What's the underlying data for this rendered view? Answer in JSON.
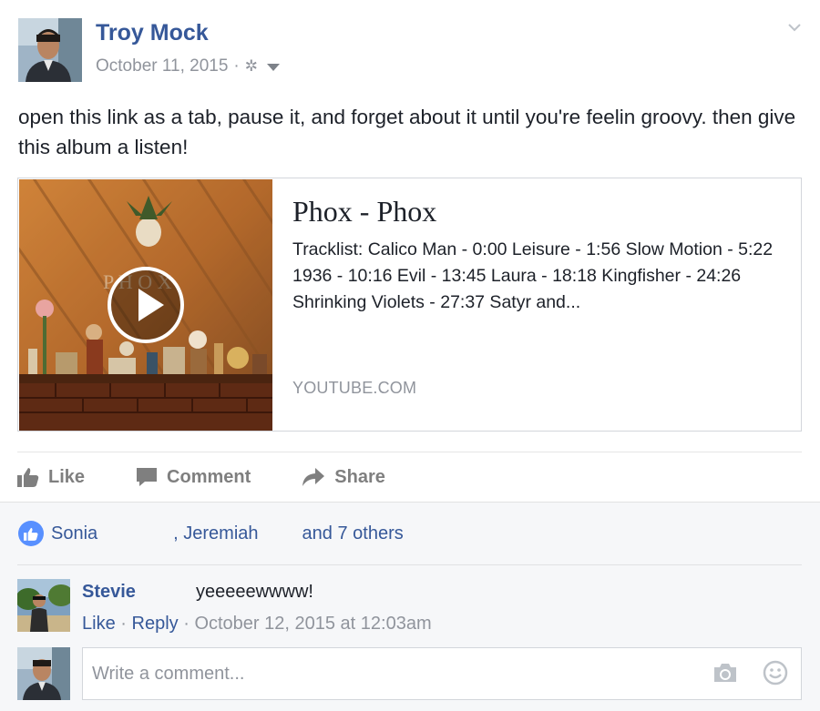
{
  "post": {
    "author": "Troy Mock",
    "date": "October 11, 2015",
    "separator": "·",
    "message": "open this link as a tab, pause it, and forget about it until you're feelin groovy. then give this album a listen!"
  },
  "link_card": {
    "title": "Phox - Phox",
    "description": "Tracklist: Calico Man - 0:00 Leisure - 1:56 Slow Motion - 5:22 1936 - 10:16 Evil - 13:45 Laura - 18:18 Kingfisher - 24:26 Shrinking Violets - 27:37 Satyr and...",
    "source": "YOUTUBE.COM"
  },
  "actions": {
    "like": "Like",
    "comment": "Comment",
    "share": "Share"
  },
  "likes": {
    "name1": "Sonia",
    "name2": ", Jeremiah",
    "others": "and 7 others"
  },
  "comment": {
    "author": "Stevie",
    "text": "yeeeeewwww!",
    "like": "Like",
    "reply": "Reply",
    "separator": "·",
    "timestamp": "October 12, 2015 at 12:03am"
  },
  "composer": {
    "placeholder": "Write a comment..."
  },
  "colors": {
    "link_blue": "#365899",
    "meta_grey": "#90949c",
    "like_badge": "#5890ff",
    "feedback_bg": "#f6f7f9"
  },
  "icons": [
    "gear-icon",
    "caret-down-icon",
    "chevron-down-icon",
    "play-icon",
    "like-icon",
    "comment-icon",
    "share-icon",
    "camera-icon",
    "smiley-icon"
  ]
}
